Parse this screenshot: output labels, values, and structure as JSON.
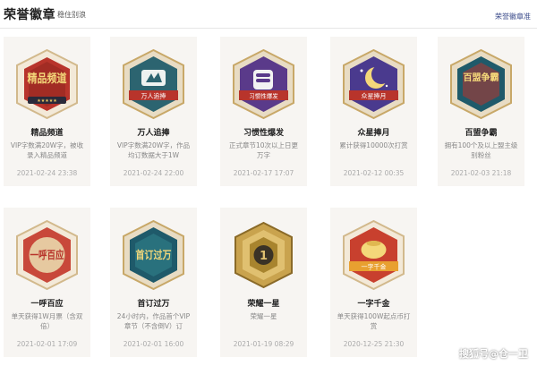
{
  "header": {
    "title": "荣誉徽章",
    "subtitle": "稳住别浪",
    "link": "荣誉徽章准"
  },
  "badges": [
    {
      "name": "精品频道",
      "desc": "VIP字数满20W字，被收录入精品频道",
      "date": "2021-02-24 23:38",
      "icon": "jingpin-pindao-badge-icon",
      "art_text": "精品频道",
      "color": "#b8342b"
    },
    {
      "name": "万人追捧",
      "desc": "VIP字数满20W字，作品均订数据大于1W",
      "date": "2021-02-24 22:00",
      "icon": "wanren-zhuipeng-badge-icon",
      "art_text": "万人追捧",
      "color": "#2c6470"
    },
    {
      "name": "习惯性爆发",
      "desc": "正式章节10次以上日更万字",
      "date": "2021-02-17 17:07",
      "icon": "xiguanxing-baofa-badge-icon",
      "art_text": "习惯性爆发",
      "color": "#5a3a8a"
    },
    {
      "name": "众星捧月",
      "desc": "累计获得10000次打赏",
      "date": "2021-02-12 00:35",
      "icon": "zhongxing-pengyue-badge-icon",
      "art_text": "众星捧月",
      "color": "#4a3a8e"
    },
    {
      "name": "百盟争霸",
      "desc": "拥有100个及以上盟主级别粉丝",
      "date": "2021-02-03 21:18",
      "icon": "baimeng-zhengba-badge-icon",
      "art_text": "百盟争霸",
      "color": "#1f5a6a"
    },
    {
      "name": "一呼百应",
      "desc": "单天获得1W月票（含双倍）",
      "date": "2021-02-01 17:09",
      "icon": "yihu-baiying-badge-icon",
      "art_text": "一呼百应",
      "color": "#c8483a"
    },
    {
      "name": "首订过万",
      "desc": "24小时内，作品首个VIP章节（不含倒V）订",
      "date": "2021-02-01 16:00",
      "icon": "shouding-guowan-badge-icon",
      "art_text": "首订过万",
      "color": "#1f5a6a"
    },
    {
      "name": "荣耀一星",
      "desc": "荣耀一星",
      "date": "2021-01-19 08:29",
      "icon": "rongyao-yixing-badge-icon",
      "art_text": "1",
      "color": "#6a5a3a"
    },
    {
      "name": "一字千金",
      "desc": "单天获得100W起点币打赏",
      "date": "2020-12-25 21:30",
      "icon": "yizi-qianjin-badge-icon",
      "art_text": "一字千金",
      "color": "#c8402e"
    }
  ],
  "watermark": "搜狐号@仓一卫"
}
